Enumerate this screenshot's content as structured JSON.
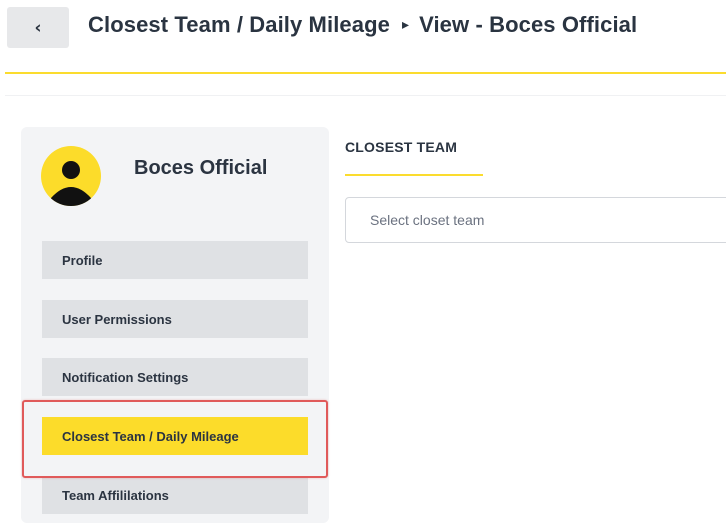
{
  "header": {
    "back_icon": "‹",
    "breadcrumb": {
      "first": "Closest Team / Daily Mileage",
      "separator": "▸",
      "second": "View - Boces Official"
    }
  },
  "profile": {
    "name": "Boces Official",
    "avatar_icon": "user-avatar-icon"
  },
  "sidebar": {
    "items": [
      {
        "label": "Profile",
        "active": false
      },
      {
        "label": "User Permissions",
        "active": false
      },
      {
        "label": "Notification Settings",
        "active": false
      },
      {
        "label": "Closest Team / Daily Mileage",
        "active": true
      },
      {
        "label": "Team Affililations",
        "active": false
      }
    ]
  },
  "main": {
    "section_title": "CLOSEST TEAM",
    "select": {
      "placeholder": "Select closet team",
      "value": ""
    }
  },
  "colors": {
    "accent_yellow": "#fcdc2a",
    "nav_bg": "#dfe1e4",
    "sidebar_bg": "#f3f4f6",
    "highlight_red": "#e05a5a",
    "text_dark": "#2b3441"
  }
}
